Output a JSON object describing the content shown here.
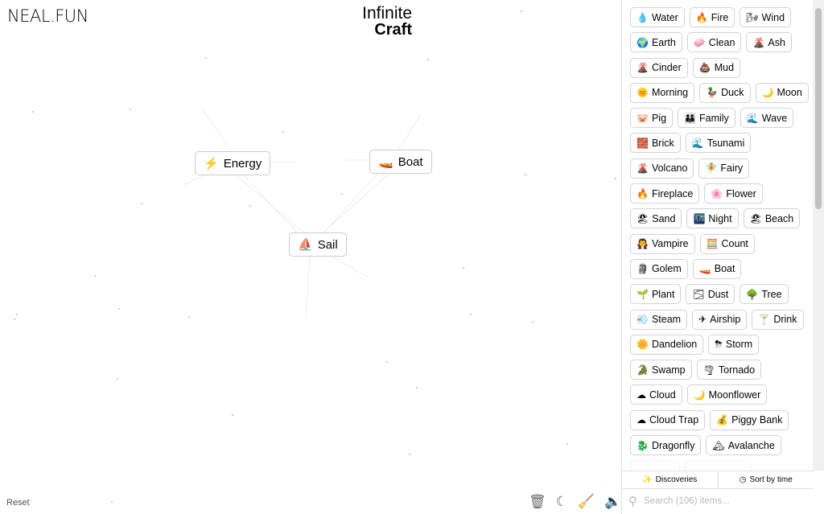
{
  "brand": {
    "logo": "NEAL.FUN",
    "title_line1": "Infinite",
    "title_line2": "Craft"
  },
  "canvas": {
    "nodes": [
      {
        "label": "Energy",
        "icon": "⚡"
      },
      {
        "label": "Boat",
        "icon": "🚤"
      },
      {
        "label": "Sail",
        "icon": "⛵"
      }
    ]
  },
  "footer": {
    "reset": "Reset",
    "tools": [
      "trash-icon",
      "moon-icon",
      "broom-icon",
      "sound-icon"
    ]
  },
  "sidebar": {
    "rows": [
      [
        {
          "icon": "💧",
          "label": "Water"
        },
        {
          "icon": "🔥",
          "label": "Fire"
        },
        {
          "icon": "🌬",
          "label": "Wind"
        }
      ],
      [
        {
          "icon": "🌍",
          "label": "Earth"
        },
        {
          "icon": "🧼",
          "label": "Clean"
        },
        {
          "icon": "🌋",
          "label": "Ash"
        }
      ],
      [
        {
          "icon": "🌋",
          "label": "Cinder"
        },
        {
          "icon": "💩",
          "label": "Mud"
        }
      ],
      [
        {
          "icon": "🌞",
          "label": "Morning"
        },
        {
          "icon": "🦆",
          "label": "Duck"
        },
        {
          "icon": "🌙",
          "label": "Moon"
        }
      ],
      [
        {
          "icon": "🐷",
          "label": "Pig"
        },
        {
          "icon": "👪",
          "label": "Family"
        },
        {
          "icon": "🌊",
          "label": "Wave"
        }
      ],
      [
        {
          "icon": "🧱",
          "label": "Brick"
        },
        {
          "icon": "🌊",
          "label": "Tsunami"
        }
      ],
      [
        {
          "icon": "🌋",
          "label": "Volcano"
        },
        {
          "icon": "🧚",
          "label": "Fairy"
        }
      ],
      [
        {
          "icon": "🔥",
          "label": "Fireplace"
        },
        {
          "icon": "🌸",
          "label": "Flower"
        }
      ],
      [
        {
          "icon": "🏖",
          "label": "Sand"
        },
        {
          "icon": "🌃",
          "label": "Night"
        },
        {
          "icon": "🏖",
          "label": "Beach"
        }
      ],
      [
        {
          "icon": "🧛",
          "label": "Vampire"
        },
        {
          "icon": "🧮",
          "label": "Count"
        }
      ],
      [
        {
          "icon": "🗿",
          "label": "Golem"
        },
        {
          "icon": "🚤",
          "label": "Boat"
        }
      ],
      [
        {
          "icon": "🌱",
          "label": "Plant"
        },
        {
          "icon": "🌫",
          "label": "Dust"
        },
        {
          "icon": "🌳",
          "label": "Tree"
        }
      ],
      [
        {
          "icon": "💨",
          "label": "Steam"
        },
        {
          "icon": "✈",
          "label": "Airship"
        },
        {
          "icon": "🍸",
          "label": "Drink"
        }
      ],
      [
        {
          "icon": "🌼",
          "label": "Dandelion"
        },
        {
          "icon": "⛈",
          "label": "Storm"
        }
      ],
      [
        {
          "icon": "🐊",
          "label": "Swamp"
        },
        {
          "icon": "🌪",
          "label": "Tornado"
        }
      ],
      [
        {
          "icon": "☁",
          "label": "Cloud"
        },
        {
          "icon": "🌙",
          "label": "Moonflower"
        }
      ],
      [
        {
          "icon": "☁",
          "label": "Cloud Trap"
        },
        {
          "icon": "💰",
          "label": "Piggy Bank"
        }
      ],
      [
        {
          "icon": "🐉",
          "label": "Dragonfly"
        },
        {
          "icon": "🏔",
          "label": "Avalanche"
        }
      ]
    ],
    "discoveries": "Discoveries",
    "sort": "Sort by time",
    "search_placeholder": "Search (106) items..."
  }
}
